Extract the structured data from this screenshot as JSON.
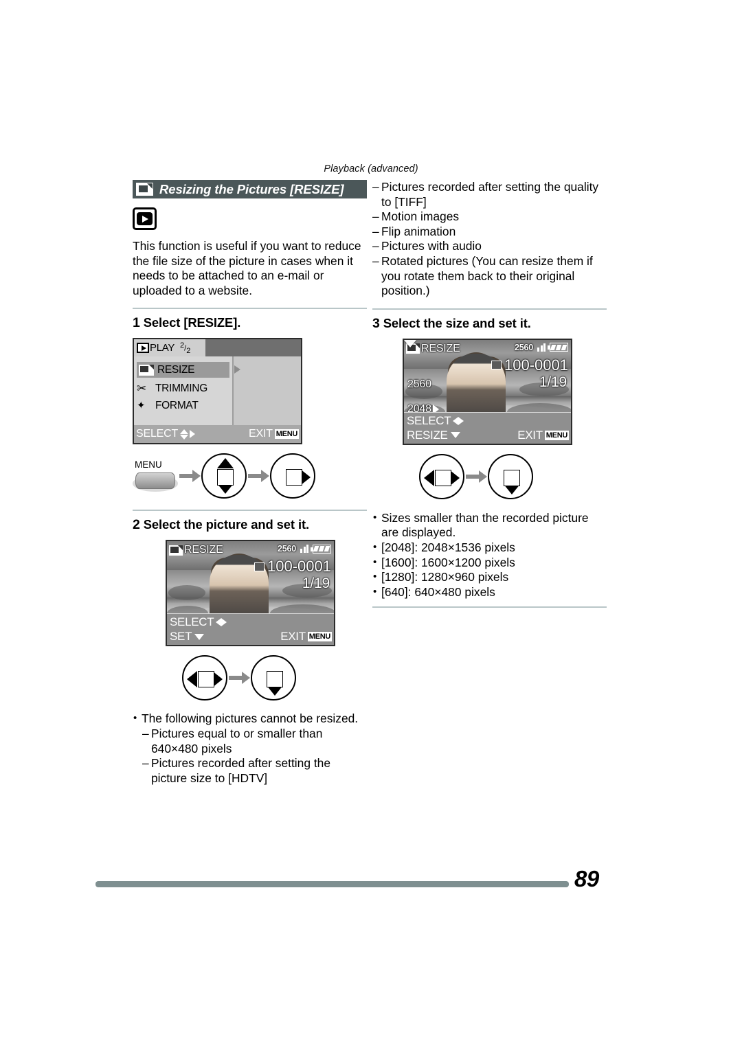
{
  "running_head": "Playback (advanced)",
  "section": {
    "icon": "resize-icon",
    "title": "Resizing the Pictures",
    "title_bracket": "[RESIZE]",
    "mode_badge_icon": "playback-mode-icon",
    "intro": "This function is useful if you want to reduce the file size of the picture in cases when it needs to be attached to an e-mail or uploaded to a website."
  },
  "steps": {
    "one": {
      "num": "1",
      "label": "Select [RESIZE]."
    },
    "two": {
      "num": "2",
      "label": "Select the picture and set it."
    },
    "three": {
      "num": "3",
      "label": "Select the size and set it."
    }
  },
  "menu_screen": {
    "tab_icon": "play-icon",
    "tab_label": "PLAY",
    "page_current": "2",
    "page_total": "2",
    "items": [
      {
        "icon": "resize-icon",
        "label": "RESIZE",
        "selected": true
      },
      {
        "icon": "scissors-icon",
        "label": "TRIMMING",
        "selected": false
      },
      {
        "icon": "format-icon",
        "label": "FORMAT",
        "selected": false
      }
    ],
    "footer_left": "SELECT",
    "footer_right": "EXIT",
    "footer_button": "MENU"
  },
  "lcd_step2": {
    "title_icon": "resize-icon",
    "title": "RESIZE",
    "picture_size": "2560",
    "quality_icon": "quality-fine-icon",
    "battery_icon": "battery-full-icon",
    "folder_file": "100-0001",
    "counter": "1/19",
    "footer_row1_label": "SELECT",
    "footer_row1_icon": "left-right-arrows-icon",
    "footer_row2_label": "SET",
    "footer_row2_icon": "down-arrow-icon",
    "footer_right": "EXIT",
    "footer_button": "MENU"
  },
  "lcd_step3": {
    "title_icon": "resize-icon",
    "title": "RESIZE",
    "picture_size": "2560",
    "quality_icon": "quality-fine-icon",
    "battery_icon": "battery-full-icon",
    "folder_file": "100-0001",
    "counter": "1/19",
    "size_current": "2560",
    "size_next": "2048",
    "footer_row1_label": "SELECT",
    "footer_row1_icon": "left-right-arrows-icon",
    "footer_row2_label": "RESIZE",
    "footer_row2_icon": "down-arrow-icon",
    "footer_right": "EXIT",
    "footer_button": "MENU"
  },
  "controls": {
    "menu_button_label": "MENU",
    "step1": [
      {
        "name": "menu-button"
      },
      {
        "name": "cursor-pad-up-down"
      },
      {
        "name": "cursor-pad-right"
      }
    ],
    "step2": [
      {
        "name": "cursor-pad-left-right"
      },
      {
        "name": "cursor-pad-down"
      }
    ],
    "step3": [
      {
        "name": "cursor-pad-left-right"
      },
      {
        "name": "cursor-pad-down"
      }
    ]
  },
  "notes_left": {
    "bullet": "The following pictures cannot be resized.",
    "dashes": [
      "Pictures equal to or smaller than 640×480 pixels",
      "Pictures recorded after setting the picture size to [HDTV]"
    ]
  },
  "notes_right_top": {
    "dashes": [
      "Pictures recorded after setting the quality to [TIFF]",
      "Motion images",
      "Flip animation",
      "Pictures with audio",
      "Rotated pictures (You can resize them if you rotate them back to their original position.)"
    ]
  },
  "notes_right_bottom": {
    "bullets": [
      "Sizes smaller than the recorded picture are displayed.",
      "[2048]:  2048×1536 pixels",
      "[1600]:  1600×1200 pixels",
      "[1280]:  1280×960 pixels",
      "[640]:    640×480 pixels"
    ]
  },
  "footer": {
    "page_number": "89"
  },
  "colors": {
    "title_bar": "#4b5759",
    "rule": "#b9c6c8",
    "footer_bar": "#7e8f90"
  }
}
